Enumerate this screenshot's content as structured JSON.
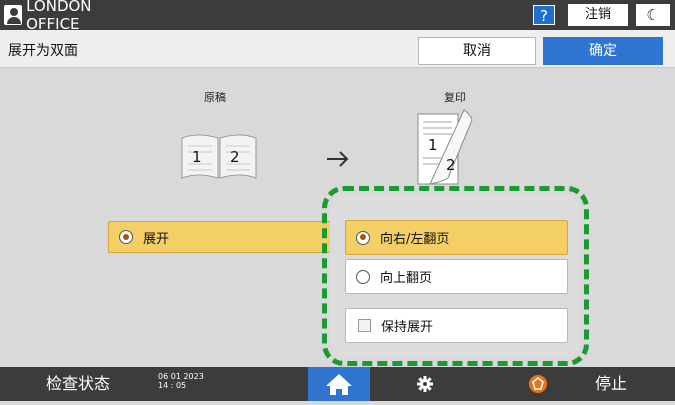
{
  "topbar": {
    "user_label": "LONDON OFFICE",
    "help_label": "?",
    "logout_label": "注销",
    "sleep_label": "☾"
  },
  "header": {
    "title": "展开为双面",
    "cancel_label": "取消",
    "ok_label": "确定"
  },
  "content": {
    "original_label": "原稿",
    "copy_label": "复印",
    "original_pages": [
      "1",
      "2"
    ],
    "copy_pages": [
      "1",
      "2"
    ],
    "expand_label": "展开",
    "expand_selected": true
  },
  "popup": {
    "options": [
      {
        "label": "向右/左翻页",
        "selected": true
      },
      {
        "label": "向上翻页",
        "selected": false
      }
    ],
    "keep_expanded_label": "保持展开",
    "keep_expanded_checked": false,
    "highlight_color": "#1a9b2f"
  },
  "bottombar": {
    "status_label": "检查状态",
    "date": "06 01 2023",
    "time": "14 : 05",
    "stop_label": "停止"
  },
  "colors": {
    "selected_bg": "#f4cf66",
    "accent_blue": "#2f74d0",
    "bar_dark": "#3c3c3c"
  }
}
